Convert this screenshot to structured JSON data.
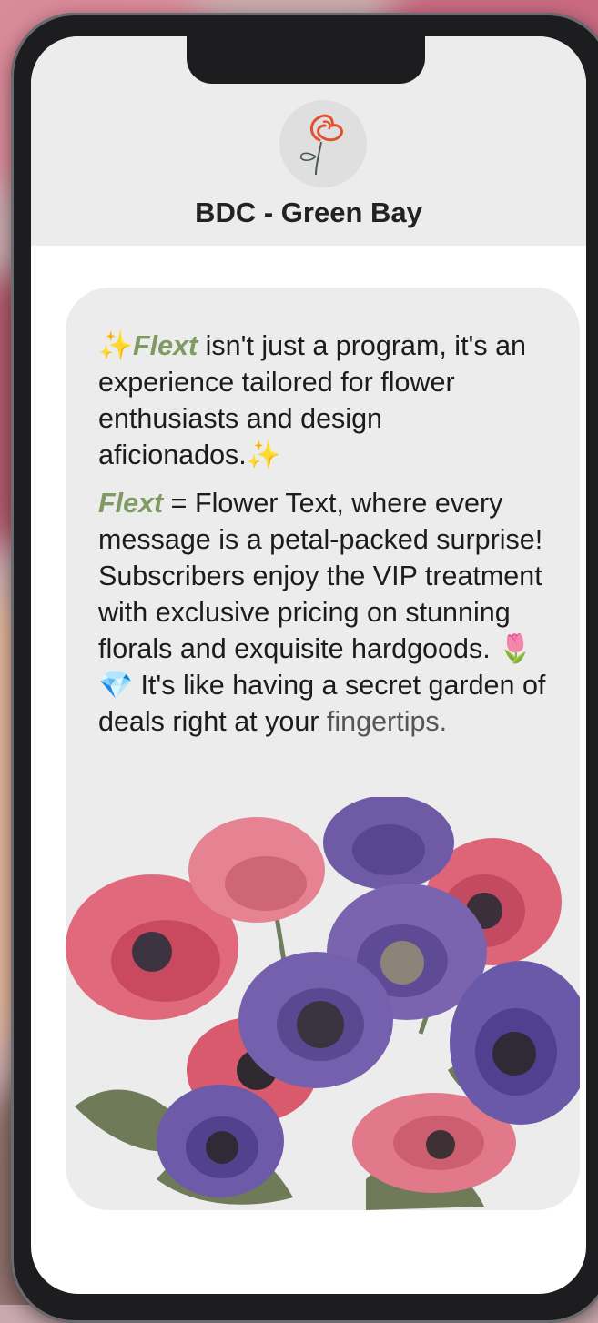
{
  "contact": {
    "name": "BDC - Green Bay"
  },
  "message": {
    "p1_prefix_emoji": "✨",
    "p1_brand": "Flext",
    "p1_text": " isn't just a program, it's an experience tailored for flower enthusiasts and design aficionados.",
    "p1_suffix_emoji": "✨",
    "p2_brand": "Flext",
    "p2_text": " = Flower Text, where every message is a petal-packed surprise! Subscribers enjoy the VIP treatment with exclusive pricing on stunning florals and exquisite hardgoods. ",
    "p2_emoji": "🌷💎",
    "p2_text2": " It's like having a secret garden of deals right at your ",
    "p2_last_word": "fingertips."
  },
  "colors": {
    "brand_accent": "#7f9a62",
    "bubble_bg": "#ececec",
    "header_bg": "#ececec",
    "poppy_pink": "#e06a7c",
    "anemone_purple": "#6f5aa6"
  },
  "icons": {
    "avatar": "red-flower-logo-icon",
    "image": "anemone-bouquet-photo"
  }
}
